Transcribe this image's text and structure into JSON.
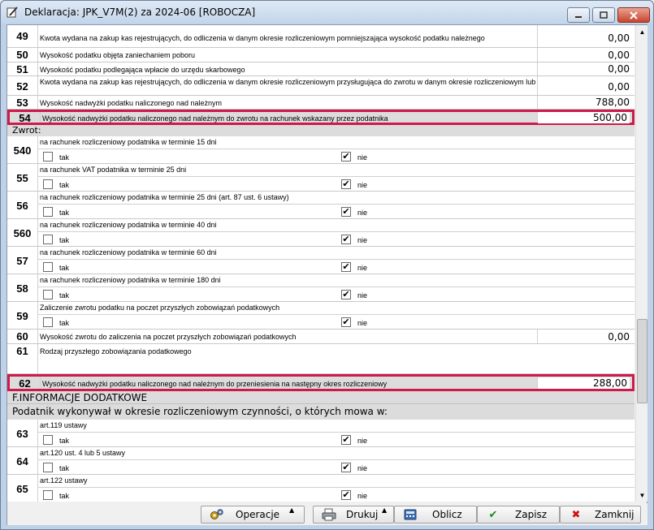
{
  "window": {
    "title": "Deklaracja: JPK_V7M(2) za 2024-06  [ROBOCZA]"
  },
  "rows_top": [
    {
      "num": "49",
      "desc": "Kwota wydana na zakup kas rejestrujących, do odliczenia w danym okresie rozliczeniowym pomniejszająca wysokość podatku należnego",
      "value": "0,00"
    },
    {
      "num": "50",
      "desc": "Wysokość podatku objęta zaniechaniem poboru",
      "value": "0,00"
    },
    {
      "num": "51",
      "desc": "Wysokość podatku podlegająca wpłacie do urzędu skarbowego",
      "value": "0,00"
    },
    {
      "num": "52",
      "desc": "Kwota wydana na zakup kas rejestrujących, do odliczenia w danym okresie rozliczeniowym przysługująca do zwrotu w danym okresie rozliczeniowym lub",
      "value": "0,00"
    },
    {
      "num": "53",
      "desc": "Wysokość nadwyżki podatku naliczonego nad należnym",
      "value": "788,00"
    },
    {
      "num": "54",
      "desc": "Wysokość nadwyżki podatku naliczonego nad należnym do zwrotu na rachunek wskazany przez podatnika",
      "value": "500,00"
    }
  ],
  "zwrot_label": "Zwrot:",
  "zwrot_groups": [
    {
      "num": "540",
      "label": "na rachunek rozliczeniowy podatnika w terminie 15 dni",
      "tak": "tak",
      "nie": "nie"
    },
    {
      "num": "55",
      "label": "na rachunek VAT podatnika w terminie 25 dni",
      "tak": "tak",
      "nie": "nie"
    },
    {
      "num": "56",
      "label": "na rachunek rozliczeniowy podatnika w terminie 25 dni (art. 87 ust. 6 ustawy)",
      "tak": "tak",
      "nie": "nie"
    },
    {
      "num": "560",
      "label": "na rachunek rozliczeniowy podatnika w terminie 40 dni",
      "tak": "tak",
      "nie": "nie"
    },
    {
      "num": "57",
      "label": "na rachunek rozliczeniowy podatnika w terminie 60 dni",
      "tak": "tak",
      "nie": "nie"
    },
    {
      "num": "58",
      "label": "na rachunek rozliczeniowy podatnika w terminie 180 dni",
      "tak": "tak",
      "nie": "nie"
    },
    {
      "num": "59",
      "label": "Zaliczenie zwrotu podatku na poczet przyszłych zobowiązań podatkowych",
      "tak": "tak",
      "nie": "nie"
    }
  ],
  "row60": {
    "num": "60",
    "desc": "Wysokość zwrotu do zaliczenia na poczet przyszłych zobowiązań podatkowych",
    "value": "0,00"
  },
  "row61": {
    "num": "61",
    "desc": "Rodzaj przyszłego zobowiązania podatkowego"
  },
  "row62": {
    "num": "62",
    "desc": "Wysokość nadwyżki podatku naliczonego nad należnym do przeniesienia na następny okres rozliczeniowy",
    "value": "288,00"
  },
  "section_f": "F.INFORMACJE DODATKOWE",
  "section_f_sub": "Podatnik wykonywał w okresie rozliczeniowym czynności, o których mowa w:",
  "f_groups": [
    {
      "num": "63",
      "label": "art.119 ustawy",
      "tak": "tak",
      "nie": "nie"
    },
    {
      "num": "64",
      "label": "art.120 ust. 4 lub 5 ustawy",
      "tak": "tak",
      "nie": "nie"
    },
    {
      "num": "65",
      "label": "art.122 ustawy",
      "tak": "tak",
      "nie": "nie"
    }
  ],
  "footer": {
    "operacje": "Operacje",
    "drukuj": "Drukuj",
    "oblicz": "Oblicz",
    "zapisz": "Zapisz",
    "zamknij": "Zamknij"
  },
  "colors": {
    "highlight": "#cc1b4a",
    "accept": "#1a8a1a",
    "reject": "#d01010"
  }
}
